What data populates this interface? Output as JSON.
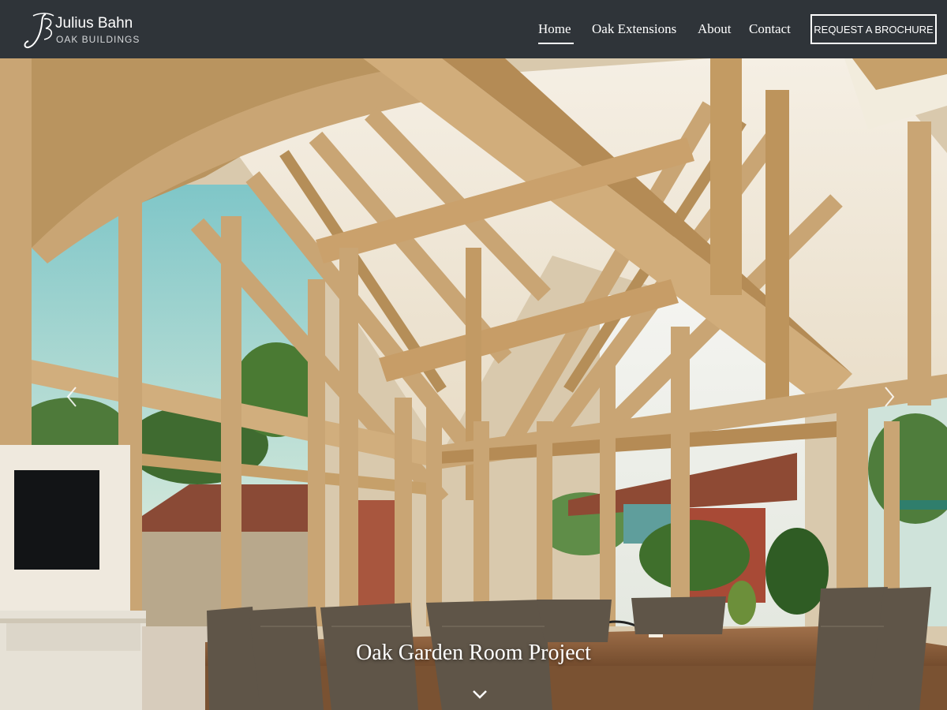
{
  "brand": {
    "name": "Julius Bahn",
    "subtitle": "OAK BUILDINGS",
    "logo_icon": "jb-monogram-icon"
  },
  "nav": {
    "items": [
      {
        "label": "Home",
        "active": true
      },
      {
        "label": "Oak Extensions",
        "active": false
      },
      {
        "label": "About",
        "active": false
      },
      {
        "label": "Contact",
        "active": false
      }
    ],
    "cta_label": "REQUEST A BROCHURE"
  },
  "hero": {
    "caption": "Oak Garden Room Project",
    "prev_icon": "chevron-left-icon",
    "next_icon": "chevron-right-icon",
    "scroll_icon": "chevron-down-icon"
  },
  "colors": {
    "header_bg": "#2f3439",
    "text": "#ffffff",
    "oak": "#c9a574",
    "ceiling": "#f1e8d8"
  }
}
